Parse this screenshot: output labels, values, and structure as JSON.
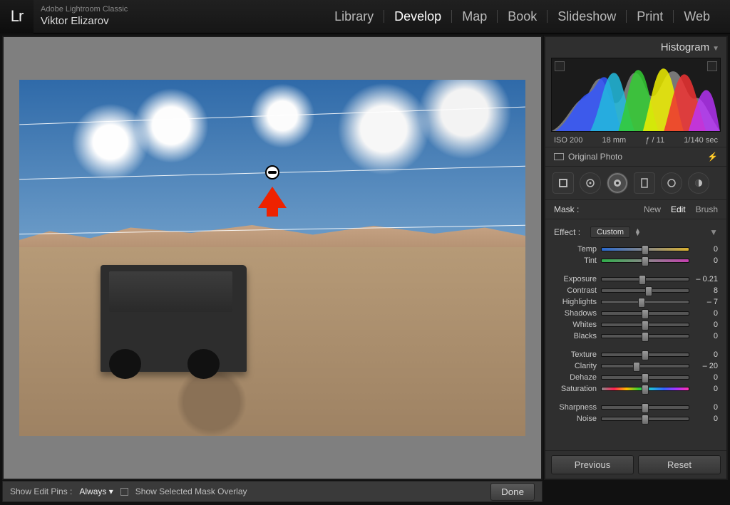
{
  "app": {
    "product": "Adobe Lightroom Classic",
    "user": "Viktor Elizarov",
    "logo": "Lr"
  },
  "nav": {
    "items": [
      "Library",
      "Develop",
      "Map",
      "Book",
      "Slideshow",
      "Print",
      "Web"
    ],
    "active": "Develop"
  },
  "canvas_bar": {
    "show_pins_label": "Show Edit Pins :",
    "show_pins_value": "Always",
    "overlay_label": "Show Selected Mask Overlay",
    "done": "Done"
  },
  "right": {
    "histogram_label": "Histogram",
    "meta": {
      "iso": "ISO 200",
      "focal": "18 mm",
      "aperture": "ƒ / 11",
      "shutter": "1/140 sec"
    },
    "original_label": "Original Photo",
    "mask": {
      "label": "Mask :",
      "new": "New",
      "edit": "Edit",
      "brush": "Brush",
      "active": "Edit"
    },
    "effect": {
      "label": "Effect :",
      "value": "Custom"
    },
    "sliders_a": [
      {
        "name": "Temp",
        "value": 0,
        "pos": 50,
        "cls": "temp"
      },
      {
        "name": "Tint",
        "value": 0,
        "pos": 50,
        "cls": "tint"
      }
    ],
    "sliders_b": [
      {
        "name": "Exposure",
        "value": "– 0.21",
        "pos": 47
      },
      {
        "name": "Contrast",
        "value": 8,
        "pos": 54
      },
      {
        "name": "Highlights",
        "value": "– 7",
        "pos": 46
      },
      {
        "name": "Shadows",
        "value": 0,
        "pos": 50
      },
      {
        "name": "Whites",
        "value": 0,
        "pos": 50
      },
      {
        "name": "Blacks",
        "value": 0,
        "pos": 50
      }
    ],
    "sliders_c": [
      {
        "name": "Texture",
        "value": 0,
        "pos": 50
      },
      {
        "name": "Clarity",
        "value": "– 20",
        "pos": 40
      },
      {
        "name": "Dehaze",
        "value": 0,
        "pos": 50
      },
      {
        "name": "Saturation",
        "value": 0,
        "pos": 50,
        "cls": "sat"
      }
    ],
    "sliders_d": [
      {
        "name": "Sharpness",
        "value": 0,
        "pos": 50
      },
      {
        "name": "Noise",
        "value": 0,
        "pos": 50
      }
    ],
    "footer": {
      "previous": "Previous",
      "reset": "Reset"
    }
  }
}
